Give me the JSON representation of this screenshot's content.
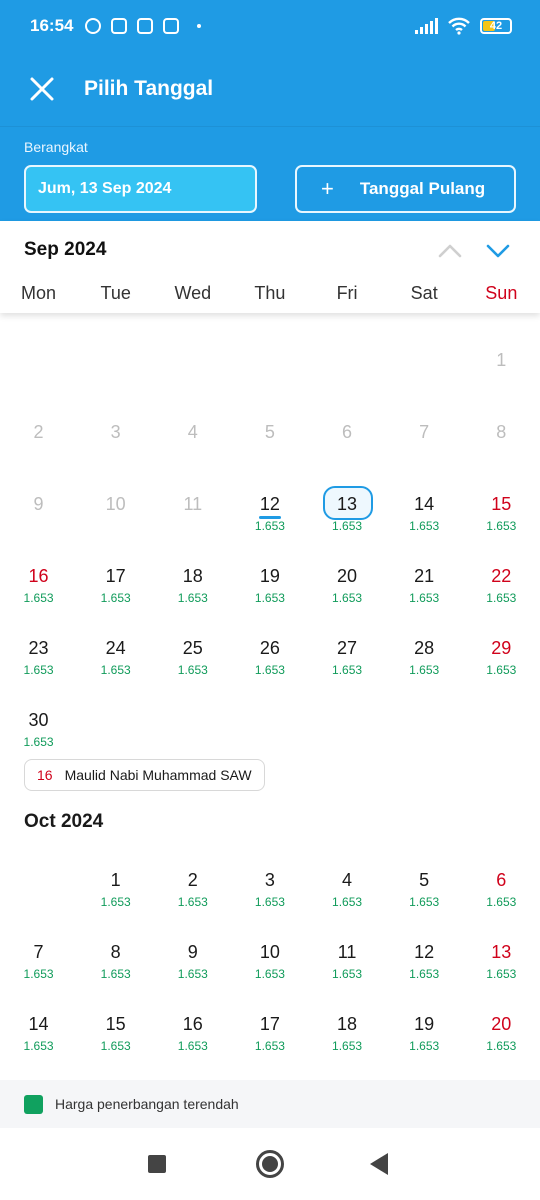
{
  "status_bar": {
    "time": "16:54",
    "battery": "42"
  },
  "app_bar": {
    "title": "Pilih Tanggal"
  },
  "date_panel": {
    "depart_label": "Berangkat",
    "depart_value": "Jum, 13 Sep 2024",
    "return_label": "Tanggal Pulang"
  },
  "weekdays": [
    "Mon",
    "Tue",
    "Wed",
    "Thu",
    "Fri",
    "Sat",
    "Sun"
  ],
  "months": [
    {
      "name": "Sep 2024",
      "lead_blanks": 6,
      "days": [
        {
          "d": "1",
          "s": "past"
        },
        {
          "d": "2",
          "s": "past"
        },
        {
          "d": "3",
          "s": "past"
        },
        {
          "d": "4",
          "s": "past"
        },
        {
          "d": "5",
          "s": "past"
        },
        {
          "d": "6",
          "s": "past"
        },
        {
          "d": "7",
          "s": "past"
        },
        {
          "d": "8",
          "s": "past"
        },
        {
          "d": "9",
          "s": "past"
        },
        {
          "d": "10",
          "s": "past"
        },
        {
          "d": "11",
          "s": "past"
        },
        {
          "d": "12",
          "p": "1.653",
          "s": "today"
        },
        {
          "d": "13",
          "p": "1.653",
          "s": "selected"
        },
        {
          "d": "14",
          "p": "1.653"
        },
        {
          "d": "15",
          "p": "1.653",
          "s": "red"
        },
        {
          "d": "16",
          "p": "1.653",
          "s": "red"
        },
        {
          "d": "17",
          "p": "1.653"
        },
        {
          "d": "18",
          "p": "1.653"
        },
        {
          "d": "19",
          "p": "1.653"
        },
        {
          "d": "20",
          "p": "1.653"
        },
        {
          "d": "21",
          "p": "1.653"
        },
        {
          "d": "22",
          "p": "1.653",
          "s": "red"
        },
        {
          "d": "23",
          "p": "1.653"
        },
        {
          "d": "24",
          "p": "1.653"
        },
        {
          "d": "25",
          "p": "1.653"
        },
        {
          "d": "26",
          "p": "1.653"
        },
        {
          "d": "27",
          "p": "1.653"
        },
        {
          "d": "28",
          "p": "1.653"
        },
        {
          "d": "29",
          "p": "1.653",
          "s": "red"
        },
        {
          "d": "30",
          "p": "1.653"
        }
      ],
      "holiday": {
        "day": "16",
        "name": "Maulid Nabi Muhammad SAW"
      }
    },
    {
      "name": "Oct 2024",
      "lead_blanks": 1,
      "days": [
        {
          "d": "1",
          "p": "1.653"
        },
        {
          "d": "2",
          "p": "1.653"
        },
        {
          "d": "3",
          "p": "1.653"
        },
        {
          "d": "4",
          "p": "1.653"
        },
        {
          "d": "5",
          "p": "1.653"
        },
        {
          "d": "6",
          "p": "1.653",
          "s": "red"
        },
        {
          "d": "7",
          "p": "1.653"
        },
        {
          "d": "8",
          "p": "1.653"
        },
        {
          "d": "9",
          "p": "1.653"
        },
        {
          "d": "10",
          "p": "1.653"
        },
        {
          "d": "11",
          "p": "1.653"
        },
        {
          "d": "12",
          "p": "1.653"
        },
        {
          "d": "13",
          "p": "1.653",
          "s": "red"
        },
        {
          "d": "14",
          "p": "1.653"
        },
        {
          "d": "15",
          "p": "1.653"
        },
        {
          "d": "16",
          "p": "1.653"
        },
        {
          "d": "17",
          "p": "1.653"
        },
        {
          "d": "18",
          "p": "1.653"
        },
        {
          "d": "19",
          "p": "1.653"
        },
        {
          "d": "20",
          "p": "1.653",
          "s": "red"
        }
      ]
    }
  ],
  "legend": {
    "text": "Harga penerbangan terendah"
  },
  "colors": {
    "primary": "#1f9be4",
    "price": "#109b5a",
    "holiday": "#d0021b"
  }
}
